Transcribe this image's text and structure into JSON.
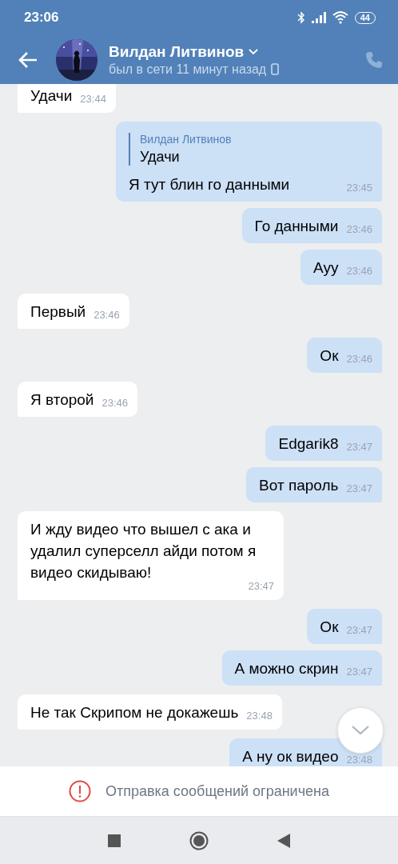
{
  "status_bar": {
    "time": "23:06",
    "battery": "44"
  },
  "header": {
    "name": "Вилдан Литвинов",
    "status": "был в сети 11 минут назад"
  },
  "messages": [
    {
      "kind": "incoming",
      "text": "Удачи",
      "time": "23:44"
    },
    {
      "kind": "outgoing",
      "text": "Я тут блин го данными",
      "time": "23:45",
      "reply": {
        "author": "Вилдан Литвинов",
        "text": "Удачи"
      }
    },
    {
      "kind": "outgoing",
      "text": "Го данными",
      "time": "23:46"
    },
    {
      "kind": "outgoing",
      "text": "Ауу",
      "time": "23:46"
    },
    {
      "kind": "incoming",
      "text": "Первый",
      "time": "23:46"
    },
    {
      "kind": "outgoing",
      "text": "Ок",
      "time": "23:46"
    },
    {
      "kind": "incoming",
      "text": "Я второй",
      "time": "23:46"
    },
    {
      "kind": "outgoing",
      "text": "Edgarik8",
      "time": "23:47"
    },
    {
      "kind": "outgoing",
      "text": "Вот пароль",
      "time": "23:47"
    },
    {
      "kind": "incoming",
      "text": "И жду видео что вышел с ака и удалил суперселл айди потом я видео скидываю!",
      "time": "23:47"
    },
    {
      "kind": "outgoing",
      "text": "Ок",
      "time": "23:47"
    },
    {
      "kind": "outgoing",
      "text": "А можно скрин",
      "time": "23:47"
    },
    {
      "kind": "incoming",
      "text": "Не так Скрипом не докажешь",
      "time": "23:48"
    },
    {
      "kind": "outgoing",
      "text": "А ну ок видео",
      "time": "23:48"
    }
  ],
  "notice": "Отправка сообщений ограничена"
}
